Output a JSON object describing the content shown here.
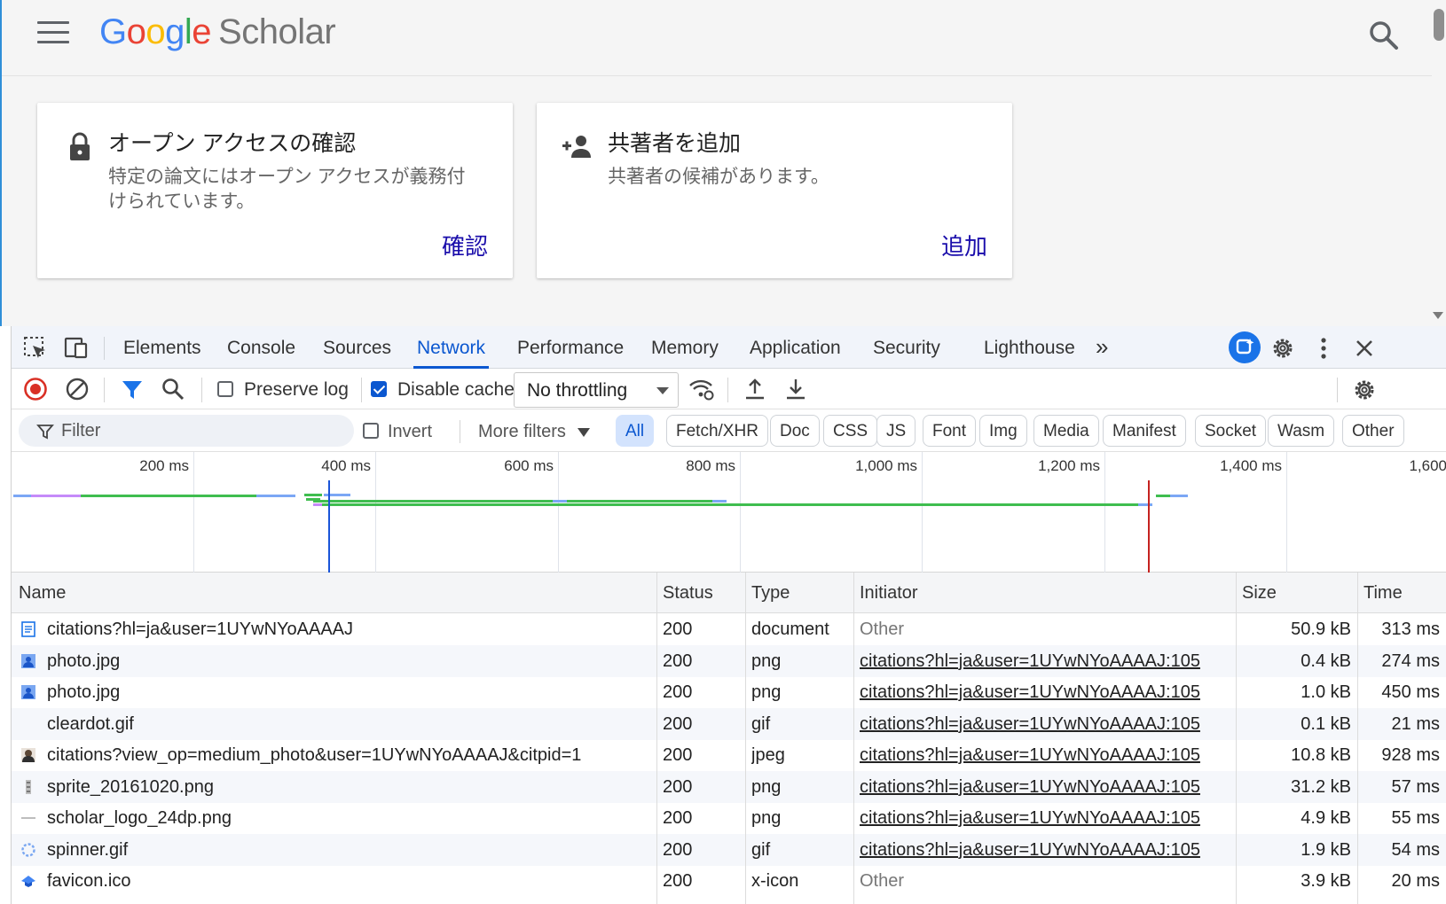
{
  "page": {
    "logo": {
      "g": "G",
      "o1": "o",
      "o2": "o",
      "g2": "g",
      "l": "l",
      "e": "e",
      "scholar": "Scholar"
    },
    "cards": [
      {
        "title": "オープン アクセスの確認",
        "desc": "特定の論文にはオープン アクセスが義務付けられています。",
        "action": "確認"
      },
      {
        "title": "共著者を追加",
        "desc": "共著者の候補があります。",
        "action": "追加"
      }
    ]
  },
  "devtools": {
    "tabs": [
      "Elements",
      "Console",
      "Sources",
      "Network",
      "Performance",
      "Memory",
      "Application",
      "Security",
      "Lighthouse"
    ],
    "active_tab": "Network",
    "more_tabs": "»",
    "toolbar": {
      "preserve_log": "Preserve log",
      "disable_cache": "Disable cache",
      "throttling": "No throttling"
    },
    "filter": {
      "placeholder": "Filter",
      "invert": "Invert",
      "more_filters": "More filters",
      "types": [
        "All",
        "Fetch/XHR",
        "Doc",
        "CSS",
        "JS",
        "Font",
        "Img",
        "Media",
        "Manifest",
        "Socket",
        "Wasm",
        "Other"
      ]
    },
    "overview": {
      "ticks": [
        "200 ms",
        "400 ms",
        "600 ms",
        "800 ms",
        "1,000 ms",
        "1,200 ms",
        "1,400 ms",
        "1,600"
      ]
    },
    "table": {
      "headers": {
        "name": "Name",
        "status": "Status",
        "type": "Type",
        "initiator": "Initiator",
        "size": "Size",
        "time": "Time"
      },
      "rows": [
        {
          "name": "citations?hl=ja&user=1UYwNYoAAAAJ",
          "status": "200",
          "type": "document",
          "initiator": "Other",
          "size": "50.9 kB",
          "time": "313 ms",
          "icon": "document-icon"
        },
        {
          "name": "photo.jpg",
          "status": "200",
          "type": "png",
          "initiator": "citations?hl=ja&user=1UYwNYoAAAAJ:105",
          "size": "0.4 kB",
          "time": "274 ms",
          "icon": "image-icon"
        },
        {
          "name": "photo.jpg",
          "status": "200",
          "type": "png",
          "initiator": "citations?hl=ja&user=1UYwNYoAAAAJ:105",
          "size": "1.0 kB",
          "time": "450 ms",
          "icon": "image-icon"
        },
        {
          "name": "cleardot.gif",
          "status": "200",
          "type": "gif",
          "initiator": "citations?hl=ja&user=1UYwNYoAAAAJ:105",
          "size": "0.1 kB",
          "time": "21 ms",
          "icon": "blank-icon"
        },
        {
          "name": "citations?view_op=medium_photo&user=1UYwNYoAAAAJ&citpid=1",
          "status": "200",
          "type": "jpeg",
          "initiator": "citations?hl=ja&user=1UYwNYoAAAAJ:105",
          "size": "10.8 kB",
          "time": "928 ms",
          "icon": "photo-icon"
        },
        {
          "name": "sprite_20161020.png",
          "status": "200",
          "type": "png",
          "initiator": "citations?hl=ja&user=1UYwNYoAAAAJ:105",
          "size": "31.2 kB",
          "time": "57 ms",
          "icon": "sprite-icon"
        },
        {
          "name": "scholar_logo_24dp.png",
          "status": "200",
          "type": "png",
          "initiator": "citations?hl=ja&user=1UYwNYoAAAAJ:105",
          "size": "4.9 kB",
          "time": "55 ms",
          "icon": "logo-thumb-icon"
        },
        {
          "name": "spinner.gif",
          "status": "200",
          "type": "gif",
          "initiator": "citations?hl=ja&user=1UYwNYoAAAAJ:105",
          "size": "1.9 kB",
          "time": "54 ms",
          "icon": "spinner-icon"
        },
        {
          "name": "favicon.ico",
          "status": "200",
          "type": "x-icon",
          "initiator": "Other",
          "size": "3.9 kB",
          "time": "20 ms",
          "icon": "favicon-icon"
        }
      ]
    }
  },
  "colors": {
    "accent": "#0b57d0",
    "link": "#1a0dab",
    "record": "#d93025"
  }
}
